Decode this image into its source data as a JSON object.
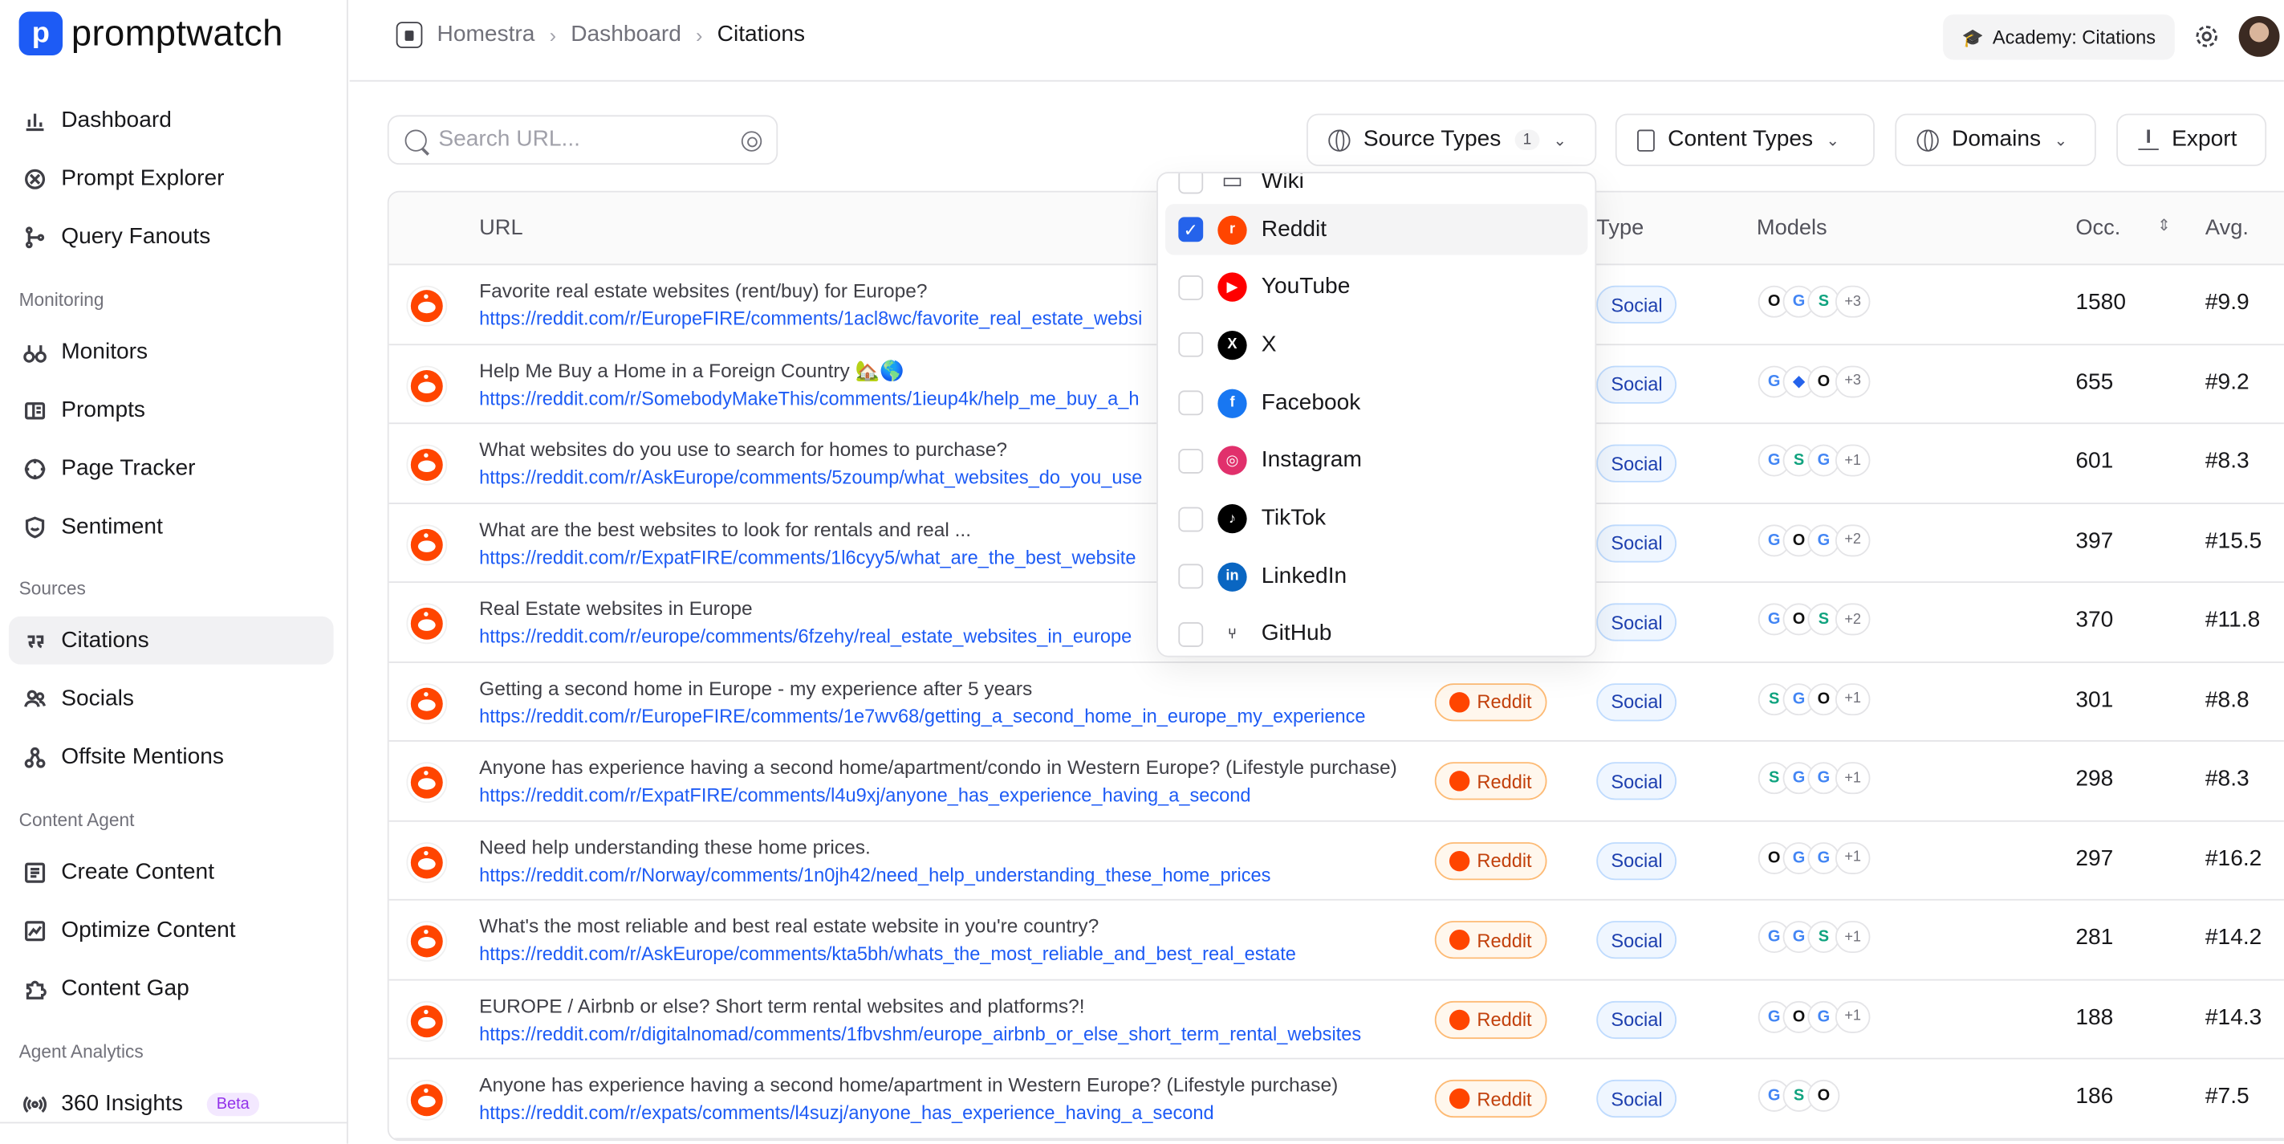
{
  "app": {
    "name": "promptwatch"
  },
  "sidebar": {
    "items_top": [
      {
        "label": "Dashboard",
        "icon": "bar-chart-icon"
      },
      {
        "label": "Prompt Explorer",
        "icon": "compass-icon"
      },
      {
        "label": "Query Fanouts",
        "icon": "branch-icon"
      }
    ],
    "sections": [
      {
        "label": "Monitoring",
        "items": [
          {
            "label": "Monitors",
            "icon": "binoculars-icon"
          },
          {
            "label": "Prompts",
            "icon": "message-icon"
          },
          {
            "label": "Page Tracker",
            "icon": "target-icon"
          },
          {
            "label": "Sentiment",
            "icon": "shield-smile-icon"
          }
        ]
      },
      {
        "label": "Sources",
        "items": [
          {
            "label": "Citations",
            "icon": "quote-icon",
            "active": true
          },
          {
            "label": "Socials",
            "icon": "users-icon"
          },
          {
            "label": "Offsite Mentions",
            "icon": "nodes-icon"
          }
        ]
      },
      {
        "label": "Content Agent",
        "items": [
          {
            "label": "Create Content",
            "icon": "doc-icon"
          },
          {
            "label": "Optimize Content",
            "icon": "image-chart-icon"
          },
          {
            "label": "Content Gap",
            "icon": "puzzle-icon"
          }
        ]
      },
      {
        "label": "Agent Analytics",
        "items": [
          {
            "label": "360 Insights",
            "icon": "broadcast-icon",
            "badge": "Beta"
          }
        ]
      }
    ]
  },
  "header": {
    "breadcrumb": [
      "Homestra",
      "Dashboard",
      "Citations"
    ],
    "academy_label": "Academy: Citations"
  },
  "toolbar": {
    "search_placeholder": "Search URL...",
    "source_types_label": "Source Types",
    "source_types_count": "1",
    "content_types_label": "Content Types",
    "domains_label": "Domains",
    "export_label": "Export"
  },
  "table": {
    "headers": {
      "url": "URL",
      "type": "Type",
      "models": "Models",
      "occ": "Occ.",
      "avg": "Avg."
    },
    "rows": [
      {
        "title": "Favorite real estate websites (rent/buy) for Europe?",
        "url": "https://reddit.com/r/EuropeFIRE/comments/1acl8wc/favorite_real_estate_websi",
        "source": "",
        "type": "Social",
        "models": [
          "O",
          "G",
          "S"
        ],
        "more": "+3",
        "occ": "1580",
        "avg": "#9.9"
      },
      {
        "title": "Help Me Buy a Home in a Foreign Country 🏡🌎",
        "url": "https://reddit.com/r/SomebodyMakeThis/comments/1ieup4k/help_me_buy_a_h",
        "source": "",
        "type": "Social",
        "models": [
          "G",
          "◆",
          "O"
        ],
        "more": "+3",
        "occ": "655",
        "avg": "#9.2"
      },
      {
        "title": "What websites do you use to search for homes to purchase?",
        "url": "https://reddit.com/r/AskEurope/comments/5zoump/what_websites_do_you_use",
        "source": "",
        "type": "Social",
        "models": [
          "G",
          "S",
          "G"
        ],
        "more": "+1",
        "occ": "601",
        "avg": "#8.3"
      },
      {
        "title": "What are the best websites to look for rentals and real ...",
        "url": "https://reddit.com/r/ExpatFIRE/comments/1l6cyy5/what_are_the_best_website",
        "source": "",
        "type": "Social",
        "models": [
          "G",
          "O",
          "G"
        ],
        "more": "+2",
        "occ": "397",
        "avg": "#15.5"
      },
      {
        "title": "Real Estate websites in Europe",
        "url": "https://reddit.com/r/europe/comments/6fzehy/real_estate_websites_in_europe",
        "source": "",
        "type": "Social",
        "models": [
          "G",
          "O",
          "S"
        ],
        "more": "+2",
        "occ": "370",
        "avg": "#11.8"
      },
      {
        "title": "Getting a second home in Europe - my experience after 5 years",
        "url": "https://reddit.com/r/EuropeFIRE/comments/1e7wv68/getting_a_second_home_in_europe_my_experience",
        "source": "Reddit",
        "type": "Social",
        "models": [
          "S",
          "G",
          "O"
        ],
        "more": "+1",
        "occ": "301",
        "avg": "#8.8"
      },
      {
        "title": "Anyone has experience having a second home/apartment/condo in Western Europe? (Lifestyle purchase)",
        "url": "https://reddit.com/r/ExpatFIRE/comments/l4u9xj/anyone_has_experience_having_a_second",
        "source": "Reddit",
        "type": "Social",
        "models": [
          "S",
          "G",
          "G"
        ],
        "more": "+1",
        "occ": "298",
        "avg": "#8.3"
      },
      {
        "title": "Need help understanding these home prices.",
        "url": "https://reddit.com/r/Norway/comments/1n0jh42/need_help_understanding_these_home_prices",
        "source": "Reddit",
        "type": "Social",
        "models": [
          "O",
          "G",
          "G"
        ],
        "more": "+1",
        "occ": "297",
        "avg": "#16.2"
      },
      {
        "title": "What's the most reliable and best real estate website in you're country?",
        "url": "https://reddit.com/r/AskEurope/comments/kta5bh/whats_the_most_reliable_and_best_real_estate",
        "source": "Reddit",
        "type": "Social",
        "models": [
          "G",
          "G",
          "S"
        ],
        "more": "+1",
        "occ": "281",
        "avg": "#14.2"
      },
      {
        "title": "EUROPE / Airbnb or else? Short term rental websites and platforms?!",
        "url": "https://reddit.com/r/digitalnomad/comments/1fbvshm/europe_airbnb_or_else_short_term_rental_websites",
        "source": "Reddit",
        "type": "Social",
        "models": [
          "G",
          "O",
          "G"
        ],
        "more": "+1",
        "occ": "188",
        "avg": "#14.3"
      },
      {
        "title": "Anyone has experience having a second home/apartment in Western Europe? (Lifestyle purchase)",
        "url": "https://reddit.com/r/expats/comments/l4suzj/anyone_has_experience_having_a_second",
        "source": "Reddit",
        "type": "Social",
        "models": [
          "G",
          "S",
          "O"
        ],
        "more": "",
        "occ": "186",
        "avg": "#7.5"
      }
    ]
  },
  "dropdown": {
    "partial_item": "Wiki",
    "items": [
      {
        "label": "Reddit",
        "checked": true,
        "color": "#ff4500",
        "glyph": "r"
      },
      {
        "label": "YouTube",
        "checked": false,
        "color": "#ff0000",
        "glyph": "▶"
      },
      {
        "label": "X",
        "checked": false,
        "color": "#000000",
        "glyph": "X"
      },
      {
        "label": "Facebook",
        "checked": false,
        "color": "#1877f2",
        "glyph": "f"
      },
      {
        "label": "Instagram",
        "checked": false,
        "color": "#e1306c",
        "glyph": "◎"
      },
      {
        "label": "TikTok",
        "checked": false,
        "color": "#000000",
        "glyph": "♪"
      },
      {
        "label": "LinkedIn",
        "checked": false,
        "color": "#0a66c2",
        "glyph": "in"
      },
      {
        "label": "GitHub",
        "checked": false,
        "color": "#ffffff",
        "glyph": "⑂"
      }
    ]
  }
}
